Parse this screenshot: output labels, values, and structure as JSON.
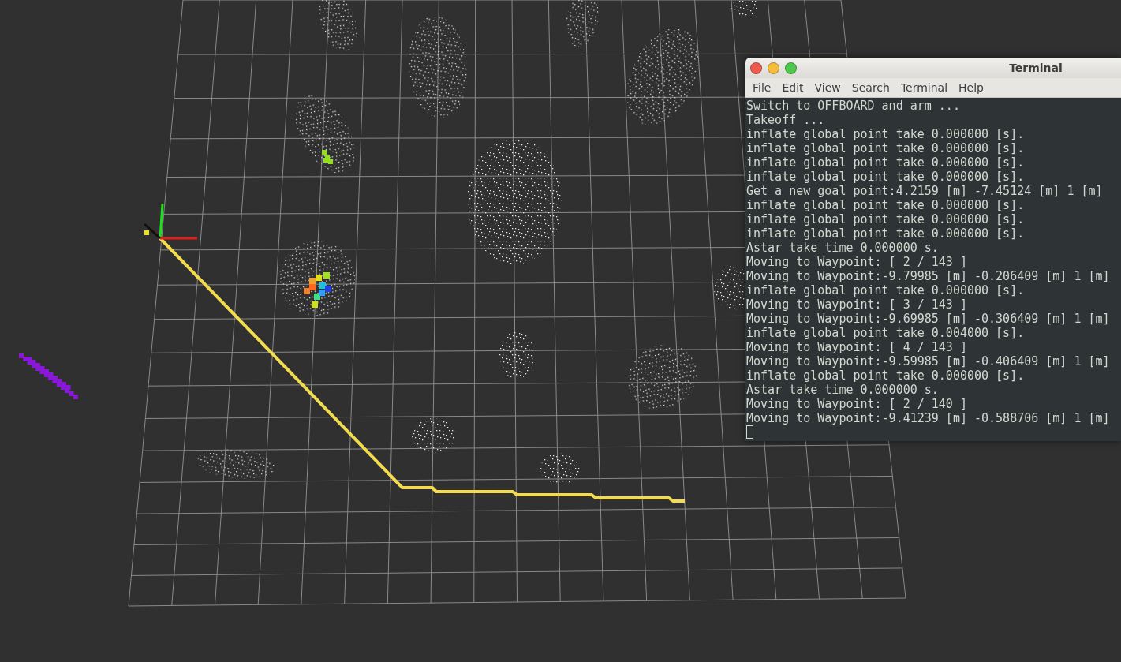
{
  "terminal": {
    "title": "Terminal",
    "menu": [
      "File",
      "Edit",
      "View",
      "Search",
      "Terminal",
      "Help"
    ],
    "lines": [
      "Switch to OFFBOARD and arm ...",
      "Takeoff ...",
      "inflate global point take 0.000000 [s].",
      "inflate global point take 0.000000 [s].",
      "inflate global point take 0.000000 [s].",
      "inflate global point take 0.000000 [s].",
      "Get a new goal point:4.2159 [m] -7.45124 [m] 1 [m]",
      "inflate global point take 0.000000 [s].",
      "inflate global point take 0.000000 [s].",
      "inflate global point take 0.000000 [s].",
      "Astar take time 0.000000 s.",
      "Moving to Waypoint: [ 2 / 143 ]",
      "Moving to Waypoint:-9.79985 [m] -0.206409 [m] 1 [m]",
      "inflate global point take 0.000000 [s].",
      "Moving to Waypoint: [ 3 / 143 ]",
      "Moving to Waypoint:-9.69985 [m] -0.306409 [m] 1 [m]",
      "inflate global point take 0.004000 [s].",
      "Moving to Waypoint: [ 4 / 143 ]",
      "Moving to Waypoint:-9.59985 [m] -0.406409 [m] 1 [m]",
      "inflate global point take 0.000000 [s].",
      "Astar take time 0.000000 s.",
      "Moving to Waypoint: [ 2 / 140 ]",
      "Moving to Waypoint:-9.41239 [m] -0.588706 [m] 1 [m]"
    ]
  }
}
